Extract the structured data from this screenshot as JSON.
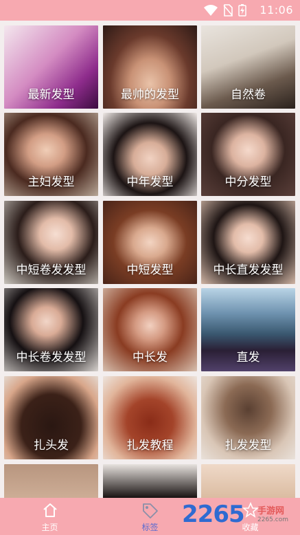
{
  "status_bar": {
    "time": "11:06"
  },
  "tiles": [
    {
      "label": "最新发型"
    },
    {
      "label": "最帅的发型"
    },
    {
      "label": "自然卷"
    },
    {
      "label": "主妇发型"
    },
    {
      "label": "中年发型"
    },
    {
      "label": "中分发型"
    },
    {
      "label": "中短卷发发型"
    },
    {
      "label": "中短发型"
    },
    {
      "label": "中长直发发型"
    },
    {
      "label": "中长卷发发型"
    },
    {
      "label": "中长发"
    },
    {
      "label": "直发"
    },
    {
      "label": "扎头发"
    },
    {
      "label": "扎发教程"
    },
    {
      "label": "扎发发型"
    }
  ],
  "tabbar": {
    "home": "主页",
    "tags": "标签",
    "favorites": "收藏"
  },
  "watermark": {
    "number": "2265",
    "text": "手游网",
    "sub": "2265.com"
  },
  "colors": {
    "accent": "#f7a9b0",
    "active_tab": "#5b6bd0"
  }
}
